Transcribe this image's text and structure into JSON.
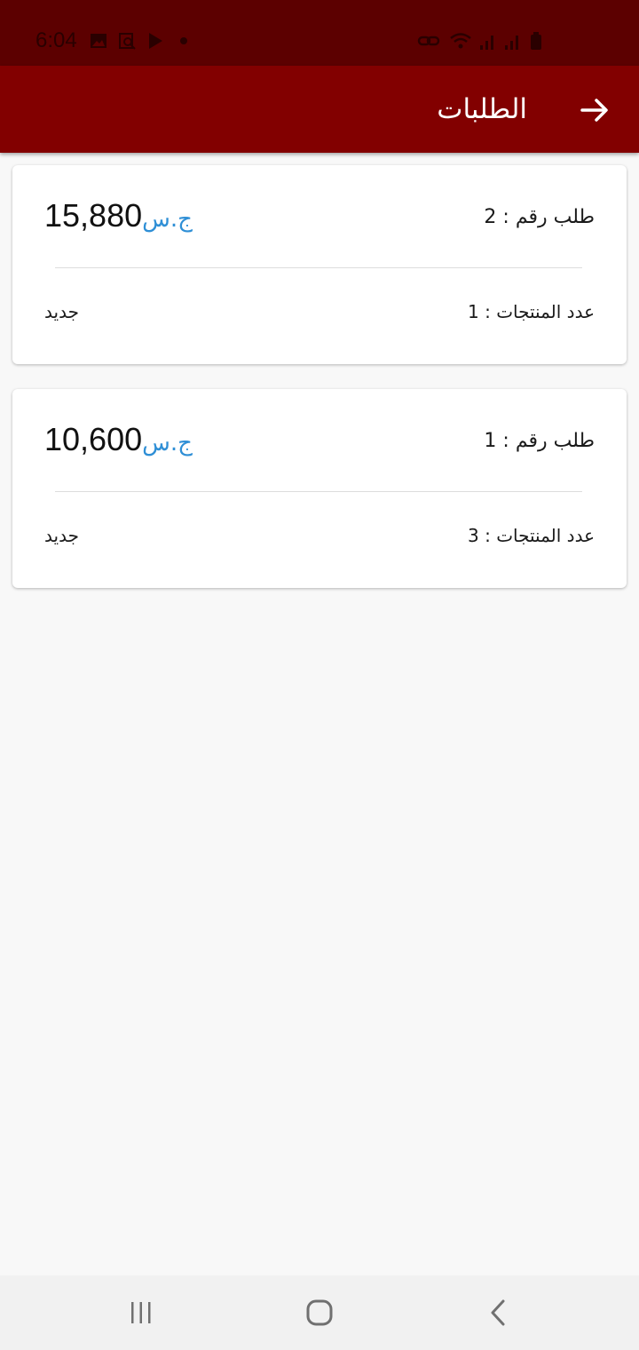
{
  "status_bar": {
    "time": "6:04",
    "left_icons": [
      "gallery-icon",
      "screenshot-icon",
      "play-store-icon",
      "dot-icon"
    ],
    "right_icons": [
      "link-icon",
      "wifi-icon",
      "signal-icon",
      "signal-icon",
      "battery-icon"
    ]
  },
  "app_bar": {
    "title": "الطلبات",
    "back_icon": "arrow-back-icon",
    "background": "#820000"
  },
  "orders": [
    {
      "number_text": "طلب رقم : 2",
      "amount": "15,880",
      "currency": "ج.س",
      "items_text": "عدد المنتجات : 1",
      "status": "جديد"
    },
    {
      "number_text": "طلب رقم : 1",
      "amount": "10,600",
      "currency": "ج.س",
      "items_text": "عدد المنتجات : 3",
      "status": "جديد"
    }
  ],
  "colors": {
    "status_bar": "#5c0000",
    "app_bar": "#820000",
    "currency": "#2f8fd6",
    "background": "#f8f8f8"
  },
  "nav_bar": {
    "buttons": [
      "recent-apps-icon",
      "home-icon",
      "back-icon"
    ]
  }
}
